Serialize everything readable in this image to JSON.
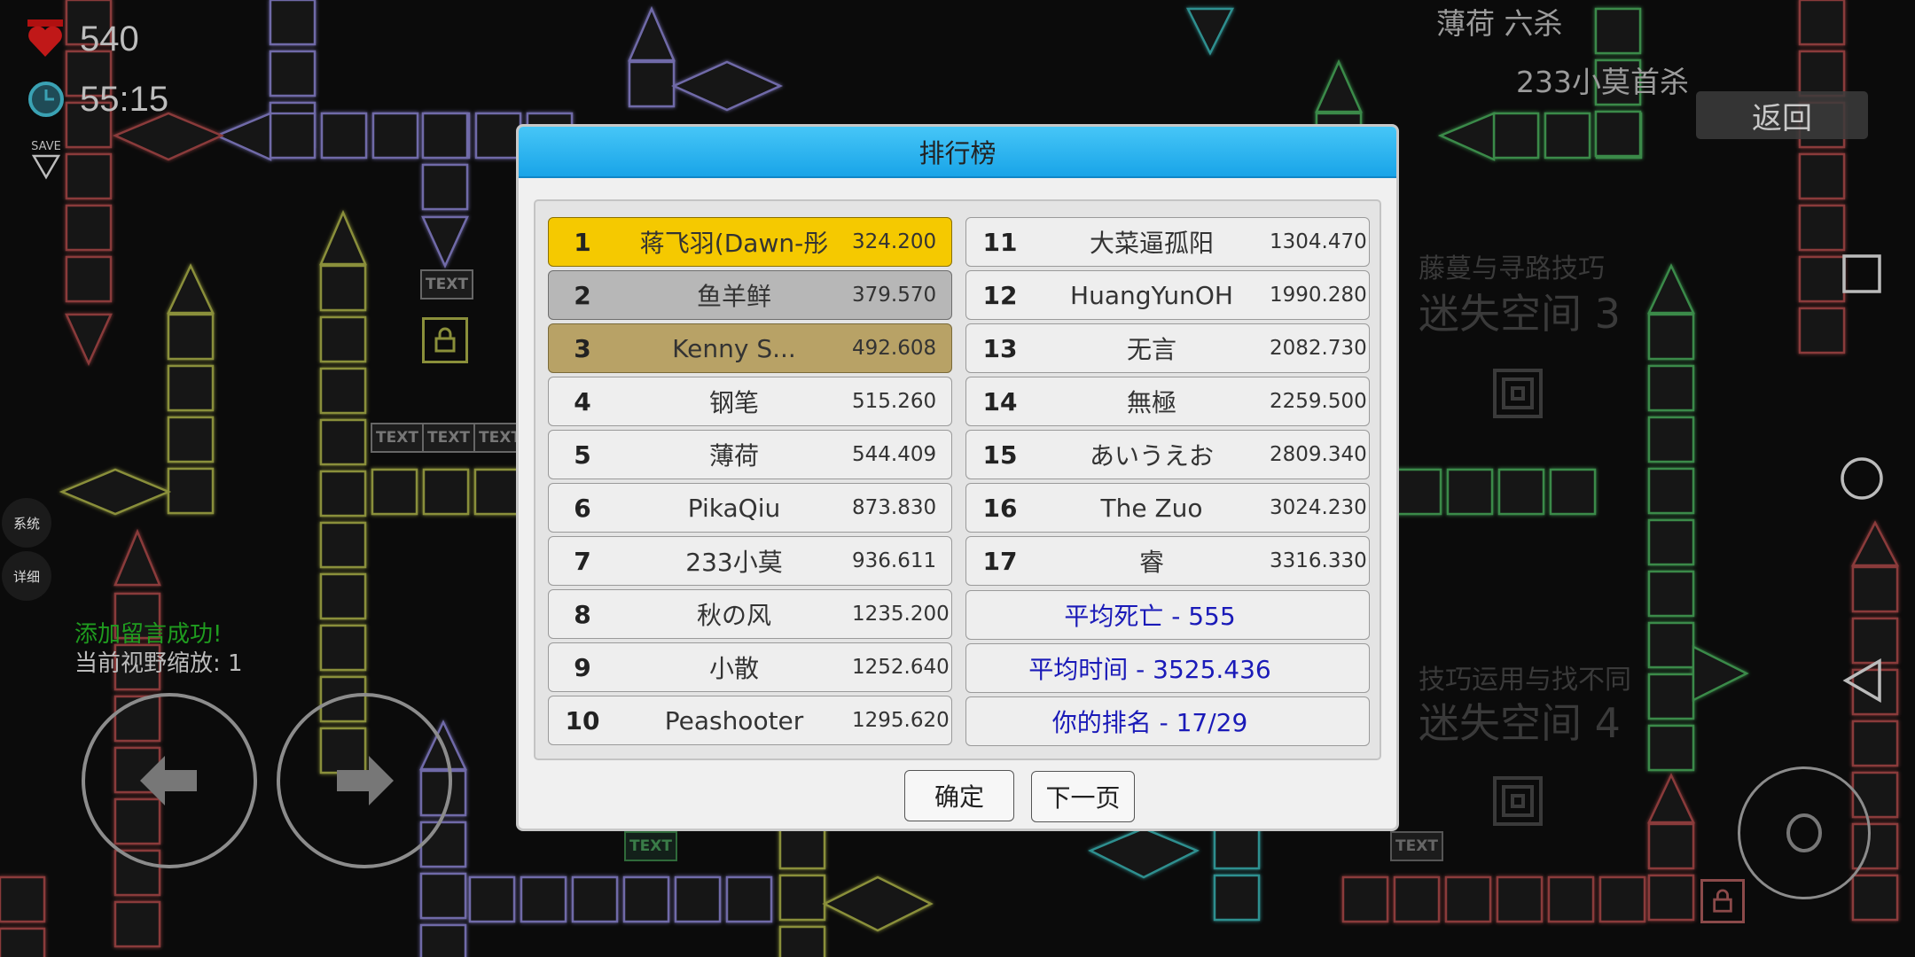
{
  "hud": {
    "deaths": "540",
    "time": "55:15",
    "save_label": "SAVE",
    "toast": "添加留言成功!",
    "zoom_text": "当前视野缩放: 1",
    "system_label": "系统",
    "detail_label": "详细",
    "back_label": "返回",
    "kill_line_1": "薄荷 六杀",
    "kill_line_2": "233小莫首杀"
  },
  "world": {
    "sign_text": "TEXT",
    "chapter3_sub": "藤蔓与寻路技巧",
    "chapter3_title": "迷失空间 3",
    "chapter4_sub": "技巧运用与找不同",
    "chapter4_title": "迷失空间 4"
  },
  "dialog": {
    "title": "排行榜",
    "confirm_label": "确定",
    "next_label": "下一页",
    "entries": [
      {
        "rank": "1",
        "name": "蒋飞羽(Dawn-彤",
        "time": "324.200"
      },
      {
        "rank": "2",
        "name": "鱼羊鲜",
        "time": "379.570"
      },
      {
        "rank": "3",
        "name": "Kenny S...",
        "time": "492.608"
      },
      {
        "rank": "4",
        "name": "钢笔",
        "time": "515.260"
      },
      {
        "rank": "5",
        "name": "薄荷",
        "time": "544.409"
      },
      {
        "rank": "6",
        "name": "PikaQiu",
        "time": "873.830"
      },
      {
        "rank": "7",
        "name": "233小莫",
        "time": "936.611"
      },
      {
        "rank": "8",
        "name": "秋の风",
        "time": "1235.200"
      },
      {
        "rank": "9",
        "name": "小散",
        "time": "1252.640"
      },
      {
        "rank": "10",
        "name": "Peashooter",
        "time": "1295.620"
      },
      {
        "rank": "11",
        "name": "大菜逼孤阳",
        "time": "1304.470"
      },
      {
        "rank": "12",
        "name": "HuangYunOH",
        "time": "1990.280"
      },
      {
        "rank": "13",
        "name": "无言",
        "time": "2082.730"
      },
      {
        "rank": "14",
        "name": "無極",
        "time": "2259.500"
      },
      {
        "rank": "15",
        "name": "あいうえお",
        "time": "2809.340"
      },
      {
        "rank": "16",
        "name": "The Zuo",
        "time": "3024.230"
      },
      {
        "rank": "17",
        "name": "睿",
        "time": "3316.330"
      }
    ],
    "stats": {
      "avg_deaths": "平均死亡 - 555",
      "avg_time": "平均时间 - 3525.436",
      "your_rank": "你的排名 - 17/29"
    }
  },
  "colors": {
    "header_blue": "#19a4e8",
    "gold": "#f5c900",
    "silver": "#b7b7b7",
    "bronze": "#b8a266",
    "stat_text": "#1a1ab8"
  }
}
